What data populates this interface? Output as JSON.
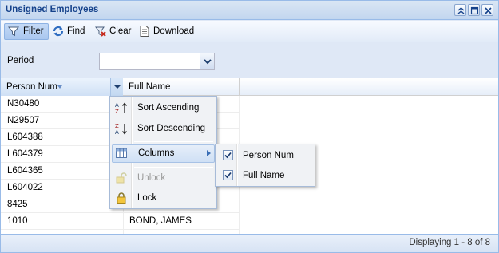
{
  "window": {
    "title": "Unsigned Employees",
    "tools": [
      "collapse-icon",
      "maximize-icon",
      "close-icon"
    ]
  },
  "toolbar": {
    "filter_label": "Filter",
    "find_label": "Find",
    "clear_label": "Clear",
    "download_label": "Download"
  },
  "filter": {
    "period_label": "Period",
    "period_value": ""
  },
  "grid": {
    "columns": [
      "Person Num",
      "Full Name"
    ],
    "sort_column": "Person Num",
    "rows": [
      {
        "person_num": "N30480",
        "full_name": ""
      },
      {
        "person_num": "N29507",
        "full_name": ""
      },
      {
        "person_num": "L604388",
        "full_name": ""
      },
      {
        "person_num": "L604379",
        "full_name": ""
      },
      {
        "person_num": "L604365",
        "full_name": ""
      },
      {
        "person_num": "L604022",
        "full_name": ""
      },
      {
        "person_num": "8425",
        "full_name": ""
      },
      {
        "person_num": "1010",
        "full_name": "BOND, JAMES"
      }
    ]
  },
  "column_menu": {
    "items": [
      {
        "label": "Sort Ascending",
        "icon": "sort-ascending-icon",
        "disabled": false
      },
      {
        "label": "Sort Descending",
        "icon": "sort-descending-icon",
        "disabled": false
      },
      {
        "label": "Columns",
        "icon": "columns-icon",
        "disabled": false,
        "active": true,
        "submenu": true
      },
      {
        "label": "Unlock",
        "icon": "unlock-icon",
        "disabled": true
      },
      {
        "label": "Lock",
        "icon": "lock-icon",
        "disabled": false
      }
    ]
  },
  "columns_submenu": {
    "items": [
      {
        "label": "Person Num",
        "checked": true
      },
      {
        "label": "Full Name",
        "checked": true
      }
    ]
  },
  "status": {
    "text": "Displaying 1 - 8 of 8"
  },
  "colors": {
    "border": "#99bbe8",
    "title_text": "#15428b",
    "panel_bg": "#dfe8f6"
  }
}
